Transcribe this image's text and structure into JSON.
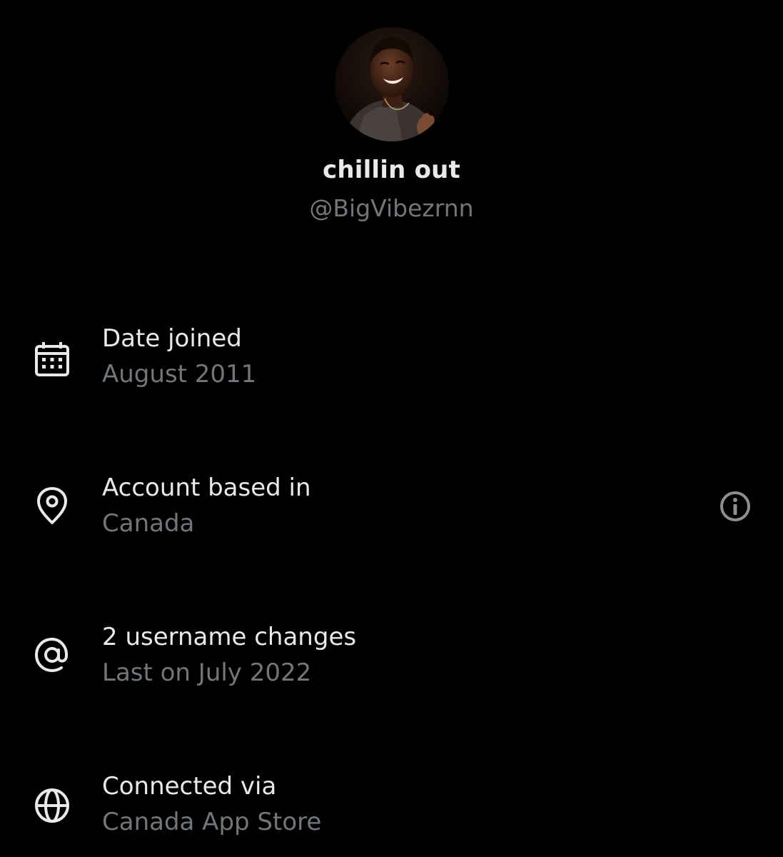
{
  "profile": {
    "display_name": "chillin out",
    "handle": "@BigVibezrnn",
    "avatar_icon": "avatar-photo"
  },
  "details": [
    {
      "icon": "calendar-icon",
      "label": "Date joined",
      "value": "August 2011"
    },
    {
      "icon": "location-pin-icon",
      "label": "Account based in",
      "value": "Canada",
      "info_icon": "info-icon"
    },
    {
      "icon": "at-sign-icon",
      "label": "2 username changes",
      "value": "Last on July 2022"
    },
    {
      "icon": "globe-icon",
      "label": "Connected via",
      "value": "Canada App Store"
    }
  ],
  "colors": {
    "background": "#000000",
    "primary_text": "#e7e9ea",
    "secondary_text": "#71767b"
  }
}
